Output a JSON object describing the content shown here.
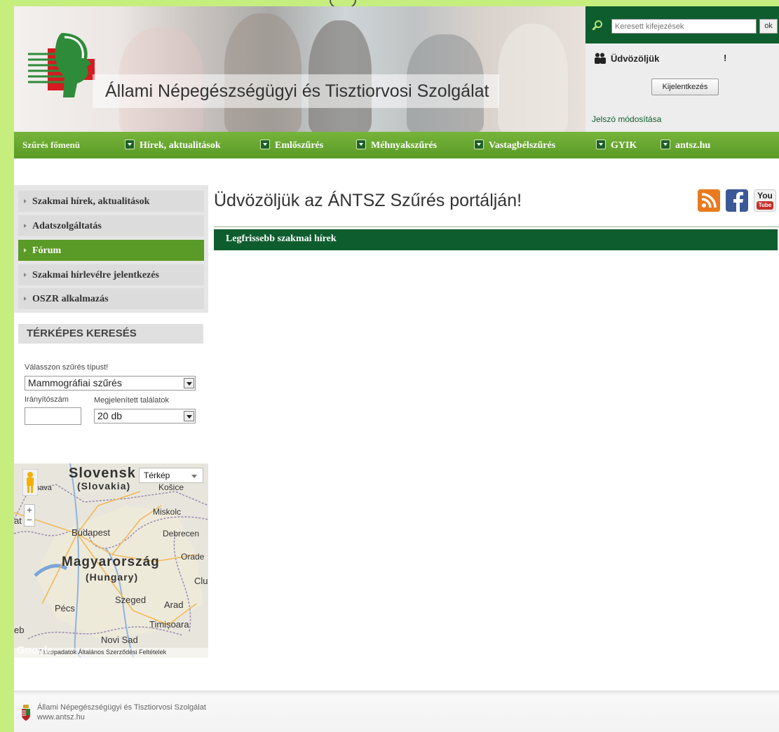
{
  "header": {
    "site_title": "Állami Népegészségügyi és Tisztiorvosi Szolgálat"
  },
  "userbox": {
    "search_placeholder": "Keresett kifejezések",
    "search_ok": "ok",
    "welcome": "Üdvözöljük",
    "welcome_suffix": "!",
    "logout": "Kijelentkezés",
    "password_change": "Jelszó módosítása"
  },
  "nav": {
    "home": "Szűrés főmenü",
    "items": [
      {
        "label": "Hírek, aktualitások"
      },
      {
        "label": "Emlőszűrés"
      },
      {
        "label": "Méhnyakszűrés"
      },
      {
        "label": "Vastagbélszűrés"
      },
      {
        "label": "GYIK"
      },
      {
        "label": "antsz.hu"
      }
    ]
  },
  "sidebar": {
    "items": [
      {
        "label": "Szakmai hírek, aktualitások",
        "active": false
      },
      {
        "label": "Adatszolgáltatás",
        "active": false
      },
      {
        "label": "Fórum",
        "active": true
      },
      {
        "label": "Szakmai hírlevélre jelentkezés",
        "active": false
      },
      {
        "label": "OSZR alkalmazás",
        "active": false
      }
    ],
    "map_search": {
      "heading": "TÉRKÉPES KERESÉS",
      "type_label": "Válasszon szűrés típust!",
      "type_value": "Mammográfiai szűrés",
      "zip_label": "Irányítószám",
      "results_label": "Megjelenített találatok",
      "results_value": "20 db"
    }
  },
  "map": {
    "type_select": "Térkép",
    "labels": {
      "slovensko": "Slovensk",
      "slovakia": "(Slovakia)",
      "kosice": "Košice",
      "nava": "nava",
      "miskolc": "Miskolc",
      "tava": "at  va",
      "budapest": "Budapest",
      "debrecen": "Debrecen",
      "magyarorszag": "Magyarország",
      "hungary": "(Hungary)",
      "oradea": "Orade",
      "cluj": "Clu",
      "szeged": "Szeged",
      "pecs": "Pécs",
      "arad": "Arad",
      "timisoara": "Timișoara",
      "eb": "eb",
      "novisad": "Novi Sad"
    },
    "google": "Google",
    "footer": "Térképadatok   Általános Szerződési Feltételek"
  },
  "main": {
    "title": "Üdvözöljük az ÁNTSZ Szűrés portálján!",
    "news_heading": "Legfrissebb szakmai hírek",
    "social": {
      "youtube_top": "You",
      "youtube_bottom": "Tube"
    }
  },
  "footer": {
    "line1": "Állami Népegészségügyi és Tisztiorvosi Szolgálat",
    "line2": "www.antsz.hu"
  },
  "colors": {
    "brand_green_dark": "#0e5d2e",
    "nav_green": "#5a9a26",
    "frame_green": "#c5ee7e"
  }
}
